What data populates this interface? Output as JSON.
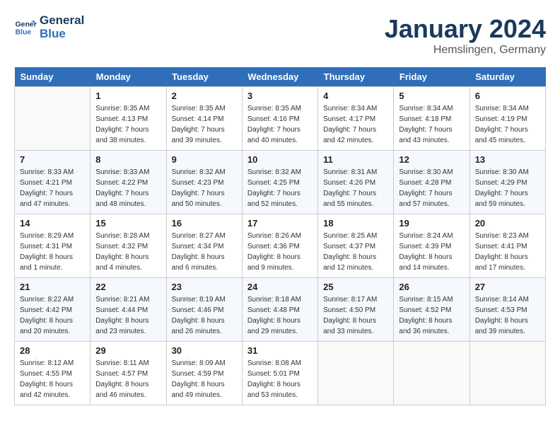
{
  "header": {
    "logo_line1": "General",
    "logo_line2": "Blue",
    "month": "January 2024",
    "location": "Hemslingen, Germany"
  },
  "days_of_week": [
    "Sunday",
    "Monday",
    "Tuesday",
    "Wednesday",
    "Thursday",
    "Friday",
    "Saturday"
  ],
  "weeks": [
    [
      {
        "day": "",
        "sunrise": "",
        "sunset": "",
        "daylight": ""
      },
      {
        "day": "1",
        "sunrise": "8:35 AM",
        "sunset": "4:13 PM",
        "daylight": "7 hours and 38 minutes."
      },
      {
        "day": "2",
        "sunrise": "8:35 AM",
        "sunset": "4:14 PM",
        "daylight": "7 hours and 39 minutes."
      },
      {
        "day": "3",
        "sunrise": "8:35 AM",
        "sunset": "4:16 PM",
        "daylight": "7 hours and 40 minutes."
      },
      {
        "day": "4",
        "sunrise": "8:34 AM",
        "sunset": "4:17 PM",
        "daylight": "7 hours and 42 minutes."
      },
      {
        "day": "5",
        "sunrise": "8:34 AM",
        "sunset": "4:18 PM",
        "daylight": "7 hours and 43 minutes."
      },
      {
        "day": "6",
        "sunrise": "8:34 AM",
        "sunset": "4:19 PM",
        "daylight": "7 hours and 45 minutes."
      }
    ],
    [
      {
        "day": "7",
        "sunrise": "8:33 AM",
        "sunset": "4:21 PM",
        "daylight": "7 hours and 47 minutes."
      },
      {
        "day": "8",
        "sunrise": "8:33 AM",
        "sunset": "4:22 PM",
        "daylight": "7 hours and 48 minutes."
      },
      {
        "day": "9",
        "sunrise": "8:32 AM",
        "sunset": "4:23 PM",
        "daylight": "7 hours and 50 minutes."
      },
      {
        "day": "10",
        "sunrise": "8:32 AM",
        "sunset": "4:25 PM",
        "daylight": "7 hours and 52 minutes."
      },
      {
        "day": "11",
        "sunrise": "8:31 AM",
        "sunset": "4:26 PM",
        "daylight": "7 hours and 55 minutes."
      },
      {
        "day": "12",
        "sunrise": "8:30 AM",
        "sunset": "4:28 PM",
        "daylight": "7 hours and 57 minutes."
      },
      {
        "day": "13",
        "sunrise": "8:30 AM",
        "sunset": "4:29 PM",
        "daylight": "7 hours and 59 minutes."
      }
    ],
    [
      {
        "day": "14",
        "sunrise": "8:29 AM",
        "sunset": "4:31 PM",
        "daylight": "8 hours and 1 minute."
      },
      {
        "day": "15",
        "sunrise": "8:28 AM",
        "sunset": "4:32 PM",
        "daylight": "8 hours and 4 minutes."
      },
      {
        "day": "16",
        "sunrise": "8:27 AM",
        "sunset": "4:34 PM",
        "daylight": "8 hours and 6 minutes."
      },
      {
        "day": "17",
        "sunrise": "8:26 AM",
        "sunset": "4:36 PM",
        "daylight": "8 hours and 9 minutes."
      },
      {
        "day": "18",
        "sunrise": "8:25 AM",
        "sunset": "4:37 PM",
        "daylight": "8 hours and 12 minutes."
      },
      {
        "day": "19",
        "sunrise": "8:24 AM",
        "sunset": "4:39 PM",
        "daylight": "8 hours and 14 minutes."
      },
      {
        "day": "20",
        "sunrise": "8:23 AM",
        "sunset": "4:41 PM",
        "daylight": "8 hours and 17 minutes."
      }
    ],
    [
      {
        "day": "21",
        "sunrise": "8:22 AM",
        "sunset": "4:42 PM",
        "daylight": "8 hours and 20 minutes."
      },
      {
        "day": "22",
        "sunrise": "8:21 AM",
        "sunset": "4:44 PM",
        "daylight": "8 hours and 23 minutes."
      },
      {
        "day": "23",
        "sunrise": "8:19 AM",
        "sunset": "4:46 PM",
        "daylight": "8 hours and 26 minutes."
      },
      {
        "day": "24",
        "sunrise": "8:18 AM",
        "sunset": "4:48 PM",
        "daylight": "8 hours and 29 minutes."
      },
      {
        "day": "25",
        "sunrise": "8:17 AM",
        "sunset": "4:50 PM",
        "daylight": "8 hours and 33 minutes."
      },
      {
        "day": "26",
        "sunrise": "8:15 AM",
        "sunset": "4:52 PM",
        "daylight": "8 hours and 36 minutes."
      },
      {
        "day": "27",
        "sunrise": "8:14 AM",
        "sunset": "4:53 PM",
        "daylight": "8 hours and 39 minutes."
      }
    ],
    [
      {
        "day": "28",
        "sunrise": "8:12 AM",
        "sunset": "4:55 PM",
        "daylight": "8 hours and 42 minutes."
      },
      {
        "day": "29",
        "sunrise": "8:11 AM",
        "sunset": "4:57 PM",
        "daylight": "8 hours and 46 minutes."
      },
      {
        "day": "30",
        "sunrise": "8:09 AM",
        "sunset": "4:59 PM",
        "daylight": "8 hours and 49 minutes."
      },
      {
        "day": "31",
        "sunrise": "8:08 AM",
        "sunset": "5:01 PM",
        "daylight": "8 hours and 53 minutes."
      },
      {
        "day": "",
        "sunrise": "",
        "sunset": "",
        "daylight": ""
      },
      {
        "day": "",
        "sunrise": "",
        "sunset": "",
        "daylight": ""
      },
      {
        "day": "",
        "sunrise": "",
        "sunset": "",
        "daylight": ""
      }
    ]
  ],
  "labels": {
    "sunrise_prefix": "Sunrise:",
    "sunset_prefix": "Sunset:",
    "daylight_prefix": "Daylight:"
  }
}
